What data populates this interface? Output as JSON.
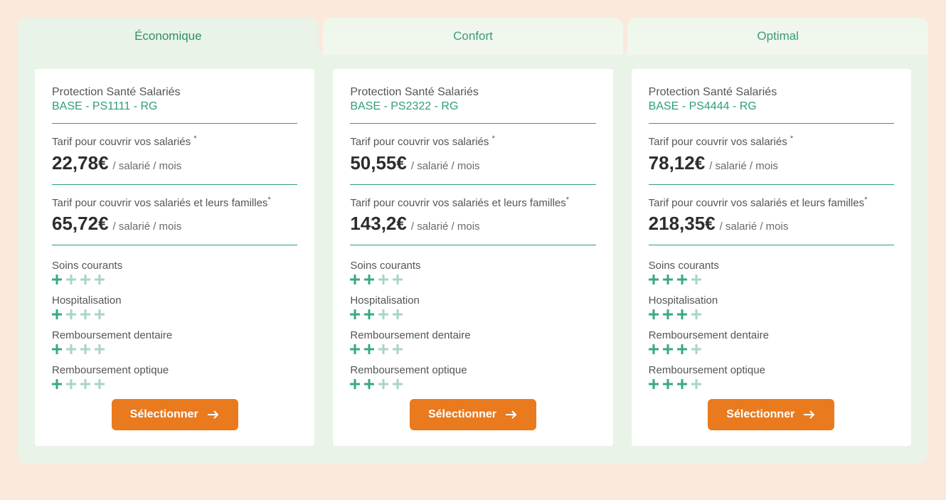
{
  "tabs": [
    {
      "label": "Économique"
    },
    {
      "label": "Confort"
    },
    {
      "label": "Optimal"
    }
  ],
  "common": {
    "product_title": "Protection Santé Salariés",
    "tarif1_label": "Tarif pour couvrir vos salariés",
    "tarif2_label": "Tarif pour couvrir vos salariés et leurs familles",
    "price_unit": "/ salarié / mois",
    "feature_soins": "Soins courants",
    "feature_hospitalisation": "Hospitalisation",
    "feature_dentaire": "Remboursement dentaire",
    "feature_optique": "Remboursement optique",
    "select_label": "Sélectionner",
    "colors": {
      "accent_green": "#2f9e78",
      "accent_orange": "#ea7a1e",
      "plus_filled": "#3aa97e",
      "plus_muted": "#a8d6c2"
    }
  },
  "plans": [
    {
      "code": "BASE - PS1111 - RG",
      "price1": "22,78€",
      "price2": "65,72€",
      "ratings": {
        "soins": 1,
        "hospitalisation": 1,
        "dentaire": 1,
        "optique": 1
      }
    },
    {
      "code": "BASE - PS2322 - RG",
      "price1": "50,55€",
      "price2": "143,2€",
      "ratings": {
        "soins": 2,
        "hospitalisation": 2,
        "dentaire": 2,
        "optique": 2
      }
    },
    {
      "code": "BASE - PS4444 - RG",
      "price1": "78,12€",
      "price2": "218,35€",
      "ratings": {
        "soins": 3,
        "hospitalisation": 3,
        "dentaire": 3,
        "optique": 3
      }
    }
  ]
}
